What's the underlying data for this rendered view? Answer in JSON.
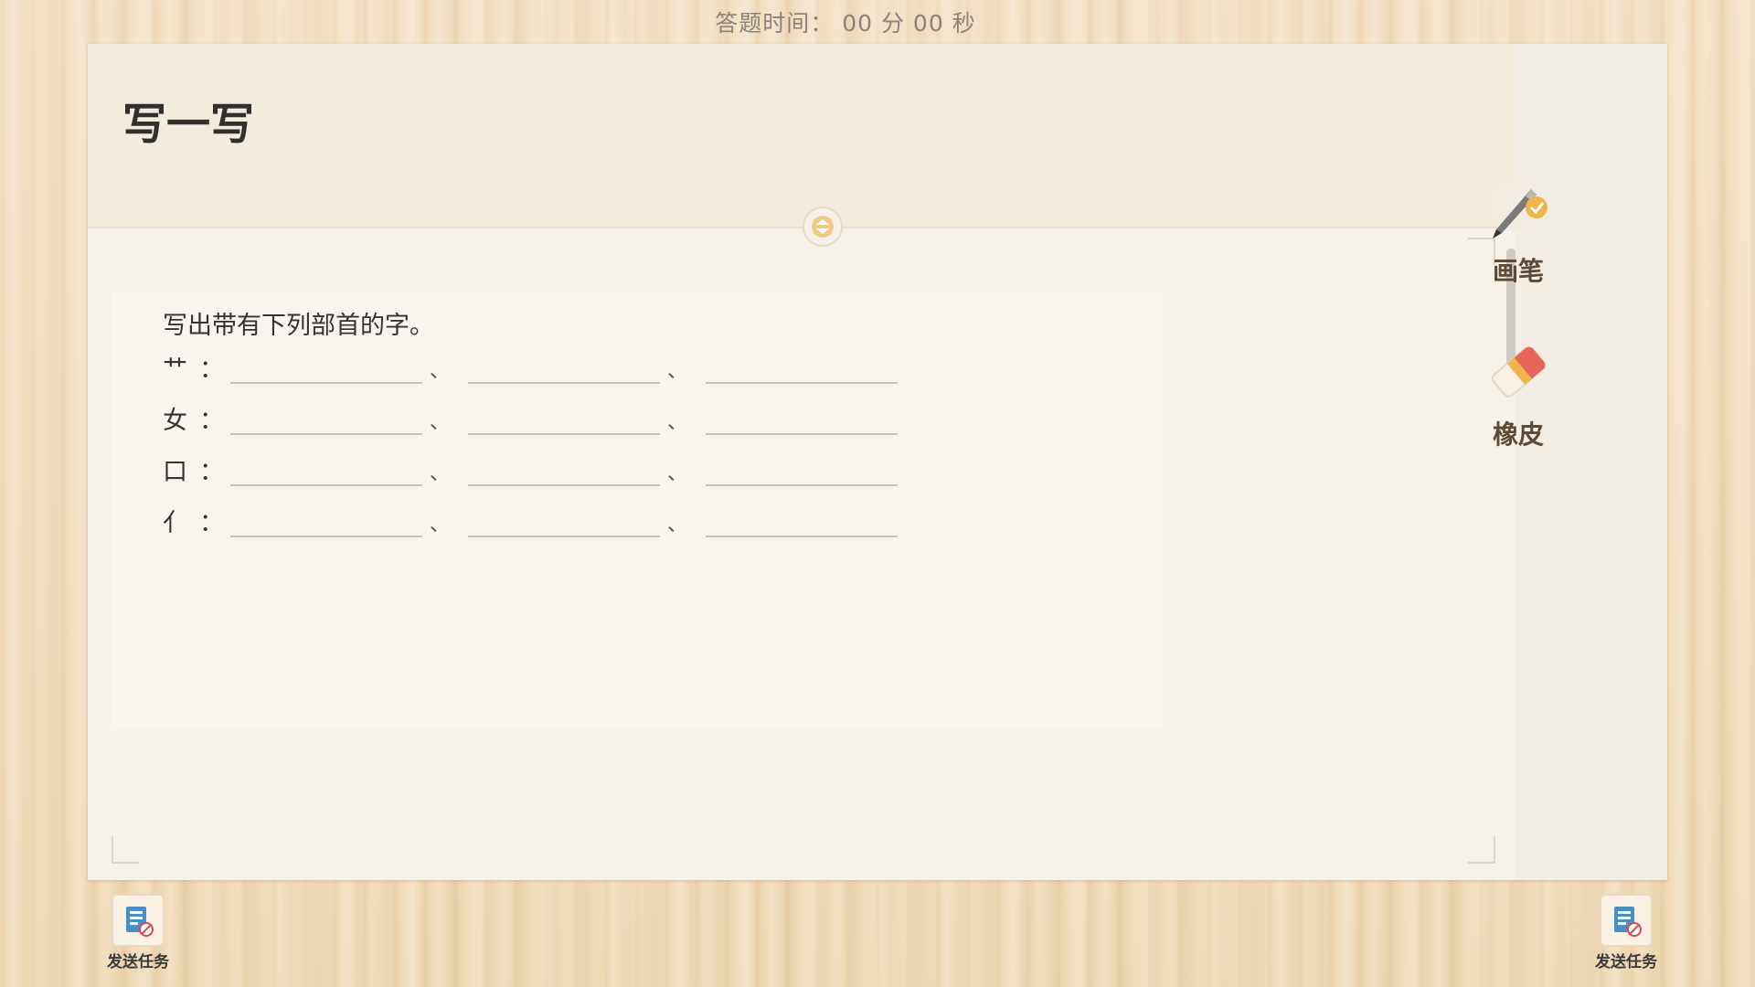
{
  "timer": {
    "text": "答题时间： 00 分 00 秒"
  },
  "header": {
    "title": "写一写"
  },
  "question": {
    "prompt": "写出带有下列部首的字。",
    "rows": [
      {
        "radical": "艹",
        "colon": "：",
        "sep": "、"
      },
      {
        "radical": "女",
        "colon": "：",
        "sep": "、"
      },
      {
        "radical": "口",
        "colon": "：",
        "sep": "、"
      },
      {
        "radical": "亻",
        "colon": "：",
        "sep": "、"
      }
    ]
  },
  "tools": {
    "pen": {
      "label": "画笔",
      "icon": "brush-icon"
    },
    "eraser": {
      "label": "橡皮",
      "icon": "eraser-icon"
    }
  },
  "send_task": {
    "left": {
      "label": "发送任务",
      "icon": "send-task-icon"
    },
    "right": {
      "label": "发送任务",
      "icon": "send-task-icon"
    }
  },
  "colors": {
    "accent_orange": "#f0b54a",
    "eraser_red": "#e8655a",
    "wood_bg": "#f1dfc0"
  }
}
